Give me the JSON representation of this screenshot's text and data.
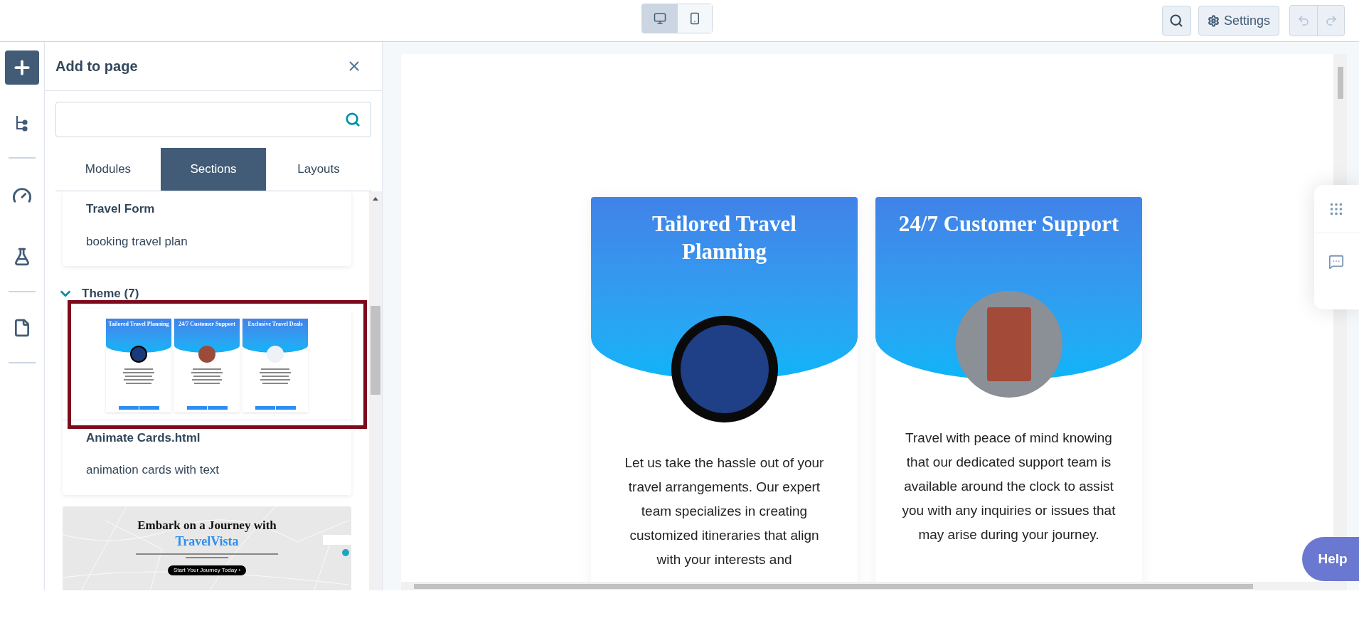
{
  "toolbar": {
    "devices": [
      {
        "kind": "desktop",
        "selected": true
      },
      {
        "kind": "mobile",
        "selected": false
      }
    ],
    "settings_label": "Settings"
  },
  "rail": [
    {
      "kind": "add",
      "selected": true
    },
    {
      "kind": "tree",
      "selected": false
    },
    {
      "kind": "gauge",
      "selected": false
    },
    {
      "kind": "flask",
      "selected": false
    },
    {
      "kind": "page",
      "selected": false
    }
  ],
  "panel": {
    "title": "Add to page",
    "tabs": [
      {
        "label": "Modules",
        "selected": false
      },
      {
        "label": "Sections",
        "selected": true
      },
      {
        "label": "Layouts",
        "selected": false
      }
    ],
    "items": [
      {
        "kind": "text",
        "title": "Travel Form",
        "description": "booking travel plan"
      },
      {
        "kind": "group",
        "label": "Theme (7)",
        "expanded": true
      },
      {
        "kind": "cards-thumbnail",
        "selected": true,
        "card_titles": [
          "Tailored Travel Planning",
          "24/7 Customer Support",
          "Exclusive Travel Deals"
        ],
        "title": "Animate Cards.html",
        "description": "animation cards with text"
      },
      {
        "kind": "hero-thumbnail",
        "heading": "Embark on a Journey with",
        "highlight": "TravelVista",
        "button": "Start Your Journey Today ›"
      }
    ]
  },
  "preview": {
    "cards": [
      {
        "title": "Tailored Travel Planning",
        "body": "Let us take the hassle out of your travel arrangements. Our expert team specializes in creating customized itineraries that align with your interests and"
      },
      {
        "title": "24/7 Customer Support",
        "body": "Travel with peace of mind knowing that our dedicated support team is available around the clock to assist you with any inquiries or issues that may arise during your journey."
      }
    ]
  },
  "help_label": "Help"
}
